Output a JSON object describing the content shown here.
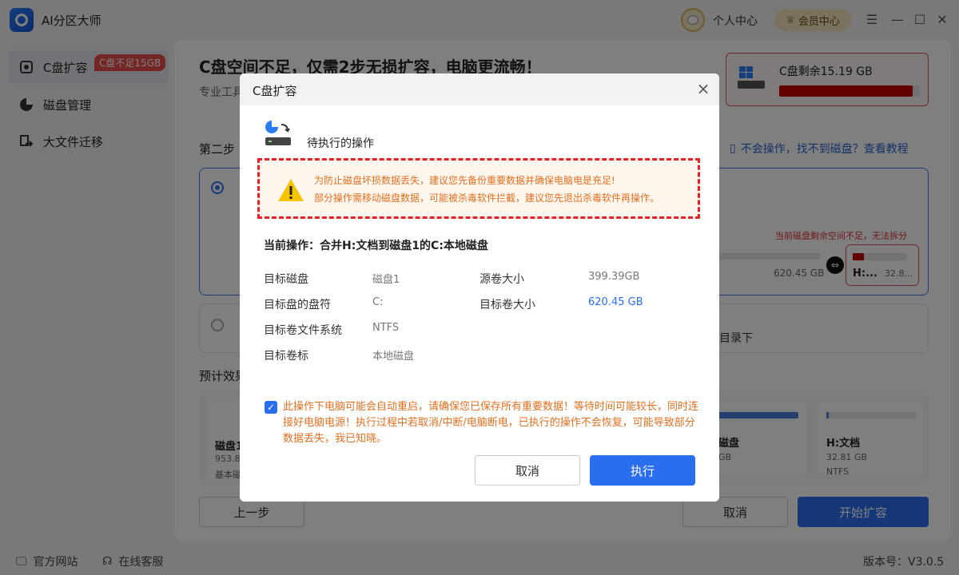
{
  "app": {
    "title": "AI分区大师",
    "personal_center": "个人中心",
    "vip_label": "会员中心",
    "version": "版本号：V3.0.5"
  },
  "sidebar": {
    "items": [
      {
        "label": "C盘扩容",
        "icon": "disk-expand-icon"
      },
      {
        "label": "磁盘管理",
        "icon": "pie-chart-icon"
      },
      {
        "label": "大文件迁移",
        "icon": "file-migrate-icon"
      }
    ],
    "badge": "C盘不足15GB"
  },
  "main": {
    "title": "C盘空间不足，仅需2步无损扩容，电脑更流畅！",
    "subtitle": "专业工具",
    "disk_status": {
      "label": "C盘剩余15.19 GB",
      "used_fraction": 0.95
    },
    "step_label": "第二步",
    "help_link": "不会操作，找不到磁盘？查看教程",
    "split_warning": "当前磁盘剩余空间不足，无法拆分",
    "option1_size": "620.45 GB",
    "option1_target": "H:...",
    "option1_target_size": "32.8...",
    "option2_text": "目录下",
    "preview_label": "预计效果",
    "preview_disk": {
      "name": "磁盘1",
      "size": "953.8...",
      "type": "基本磁盘"
    },
    "preview_part1": {
      "name": "磁盘",
      "size": "GB"
    },
    "preview_part2": {
      "name": "H:文档",
      "size": "32.81 GB",
      "fs": "NTFS"
    },
    "prev_button": "上一步",
    "cancel_button": "取消",
    "start_button": "开始扩容"
  },
  "footer": {
    "website": "官方网站",
    "support": "在线客服"
  },
  "modal": {
    "title": "C盘扩容",
    "pending_title": "待执行的操作",
    "warning_line1": "为防止磁盘坏损数据丢失，建议您先备份重要数据并确保电脑电是充足!",
    "warning_line2": "部分操作需移动磁盘数据，可能被杀毒软件拦截，建议您先退出杀毒软件再操作。",
    "current_op": "当前操作：合并H:文档到磁盘1的C:本地磁盘",
    "fields": {
      "target_disk_key": "目标磁盘",
      "target_disk_val": "磁盘1",
      "drive_letter_key": "目标盘的盘符",
      "drive_letter_val": "C:",
      "filesystem_key": "目标卷文件系统",
      "filesystem_val": "NTFS",
      "label_key": "目标卷标",
      "label_val": "本地磁盘",
      "src_size_key": "源卷大小",
      "src_size_val": "399.39GB",
      "tgt_size_key": "目标卷大小",
      "tgt_size_val": "620.45 GB"
    },
    "notice": "此操作下电脑可能会自动重启，请确保您已保存所有重要数据！等待时间可能较长，同时连接好电脑电源！执行过程中若取消/中断/电脑断电，已执行的操作不会恢复，可能导致部分数据丢失，我已知晓。",
    "notice_checked": true,
    "cancel_button": "取消",
    "execute_button": "执行"
  },
  "colors": {
    "accent": "#2a6ef0",
    "warning_text": "#e07020",
    "danger": "#e8202a"
  }
}
